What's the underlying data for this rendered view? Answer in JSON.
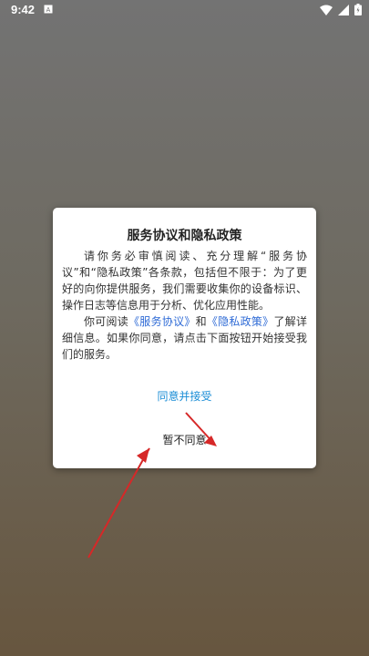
{
  "status_bar": {
    "time": "9:42",
    "notification_icon": "a-square-icon",
    "wifi_icon": "wifi-icon",
    "signal_icon": "signal-icon",
    "battery_icon": "battery-icon"
  },
  "dialog": {
    "title": "服务协议和隐私政策",
    "para1": "请你务必审慎阅读、充分理解“服务协议”和“隐私政策”各条款，包括但不限于：为了更好的向你提供服务，我们需要收集你的设备标识、操作日志等信息用于分析、优化应用性能。",
    "para2_prefix": "你可阅读",
    "service_link": "《服务协议》",
    "para2_and": "和",
    "privacy_link": "《隐私政策》",
    "para2_suffix": "了解详细信息。如果你同意，请点击下面按钮开始接受我们的服务。",
    "accept_label": "同意并接受",
    "decline_label": "暂不同意"
  },
  "colors": {
    "accent": "#1a8dd6",
    "link": "#2f6bd6",
    "annotation_arrow": "#d62828"
  }
}
